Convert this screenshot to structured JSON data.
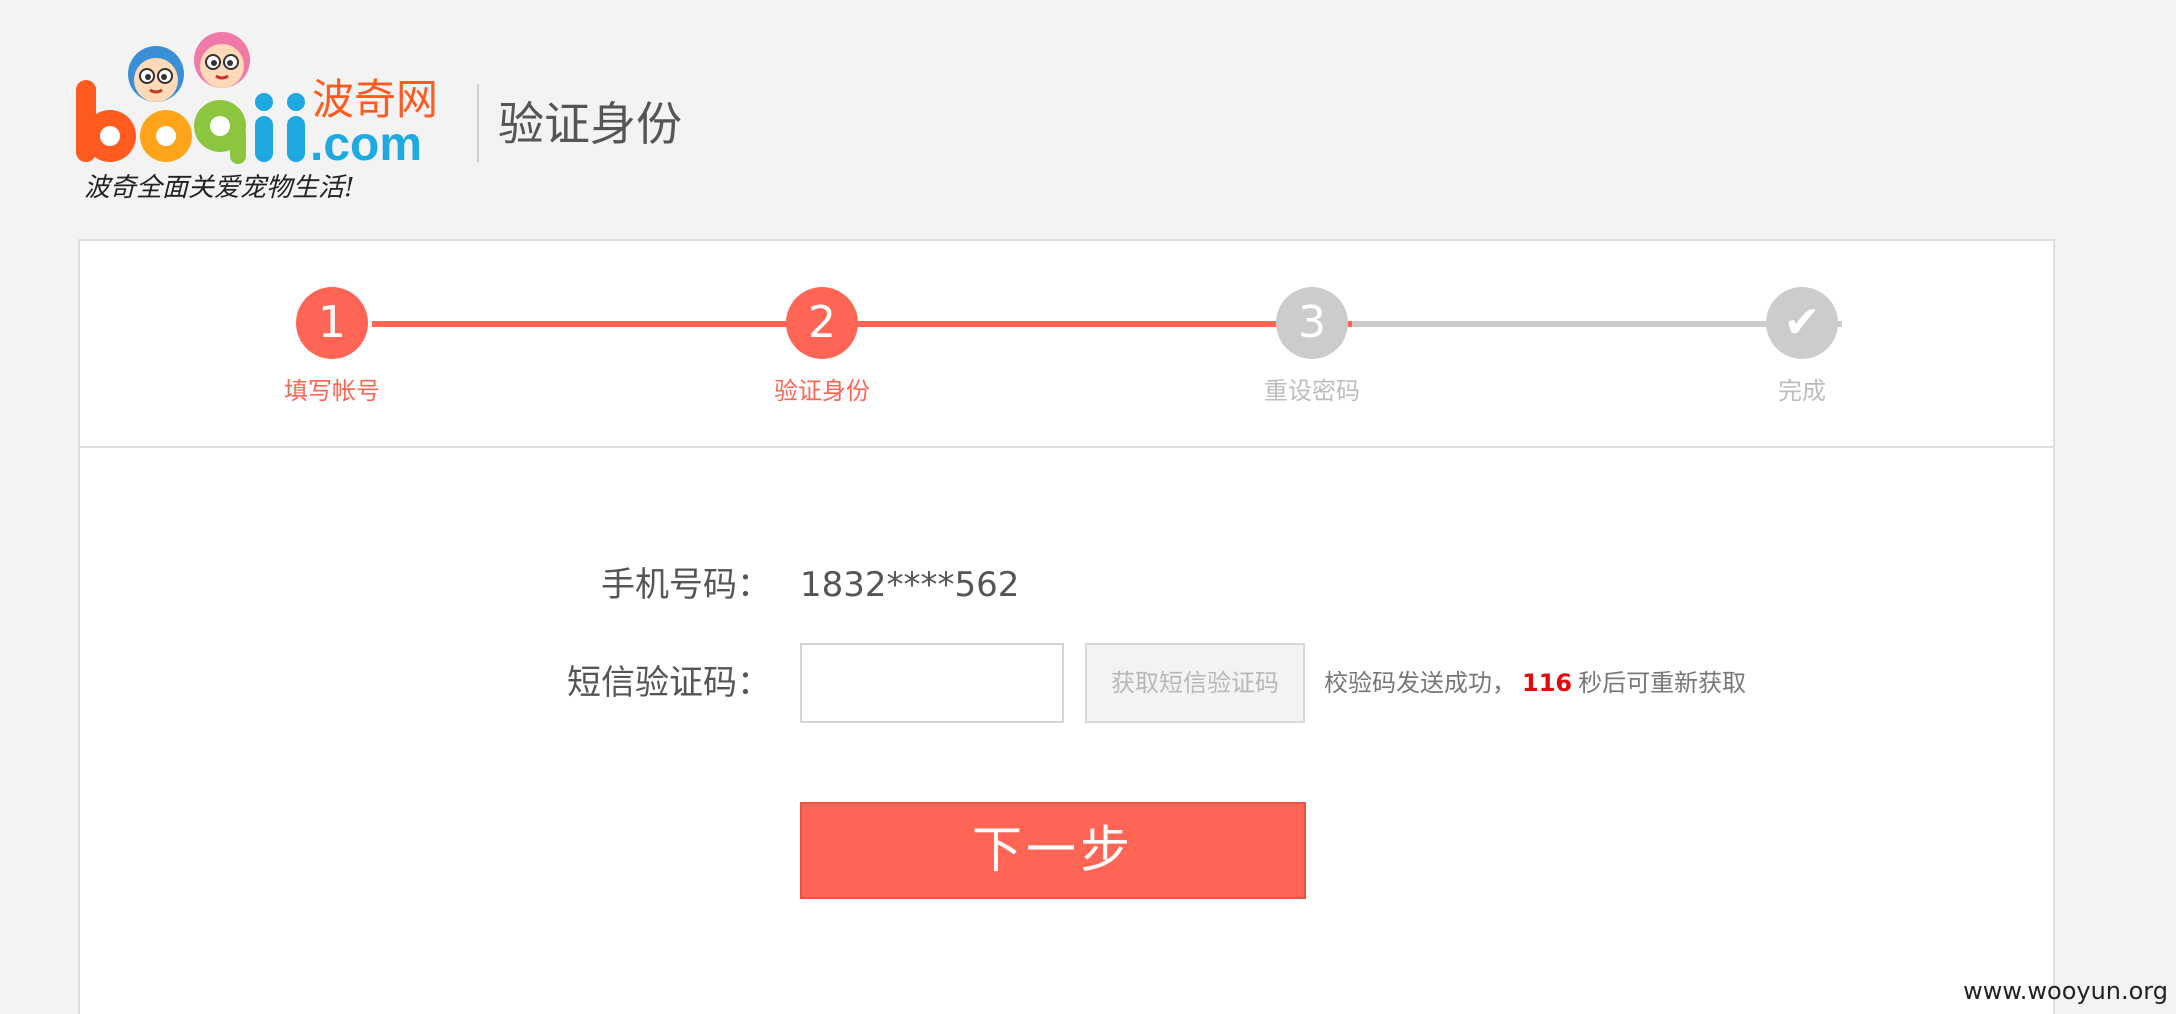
{
  "header": {
    "logo": {
      "brand_text": "boqii.com",
      "brand_cn": "波奇网",
      "slogan": "波奇全面关爱宠物生活!"
    },
    "title": "验证身份"
  },
  "steps": [
    {
      "number": "1",
      "label": "填写帐号",
      "state": "done"
    },
    {
      "number": "2",
      "label": "验证身份",
      "state": "active"
    },
    {
      "number": "3",
      "label": "重设密码",
      "state": "pending"
    },
    {
      "number": "✔",
      "label": "完成",
      "state": "pending"
    }
  ],
  "form": {
    "phone_label": "手机号码：",
    "phone_value": "1832****562",
    "sms_label": "短信验证码：",
    "sms_input_value": "",
    "sms_button_label": "获取短信验证码",
    "status_prefix": "校验码发送成功，",
    "countdown": "116",
    "status_suffix": "秒后可重新获取",
    "next_button_label": "下一步"
  },
  "colors": {
    "accent": "#ff6555",
    "pending": "#cccccc",
    "countdown": "#e4080a"
  },
  "watermark": "www.wooyun.org"
}
